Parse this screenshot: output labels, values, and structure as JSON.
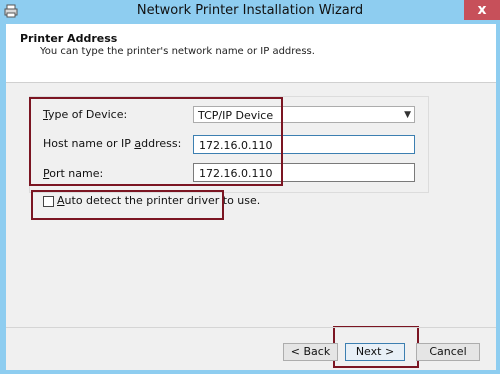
{
  "window": {
    "title": "Network Printer Installation Wizard",
    "close_glyph": "x",
    "app_icon": "printer-icon",
    "frame_color": "#8ecdf0",
    "close_color": "#c7505a"
  },
  "header": {
    "title": "Printer Address",
    "subtitle": "You can type the printer's network name or IP address."
  },
  "form": {
    "device_type": {
      "label_accel": "T",
      "label_rest": "ype of Device:",
      "value": "TCP/IP Device",
      "options_visible": [
        "TCP/IP Device"
      ]
    },
    "host": {
      "label_pre": "Host name or IP ",
      "label_accel": "a",
      "label_post": "ddress:",
      "value": "172.16.0.110"
    },
    "port": {
      "label_accel": "P",
      "label_rest": "ort name:",
      "value": "172.16.0.110"
    },
    "auto_detect": {
      "label_accel": "A",
      "label_rest": "uto detect the printer driver to use.",
      "checked": false
    }
  },
  "buttons": {
    "back": "< Back",
    "next": "Next >",
    "cancel": "Cancel"
  },
  "annotation_color": "#7b1522"
}
